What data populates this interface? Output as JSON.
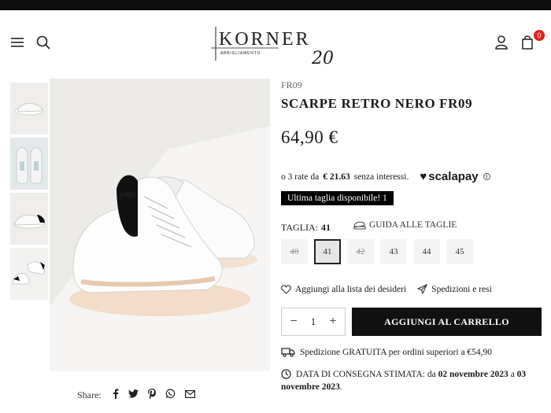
{
  "topbar": {
    "text": ""
  },
  "header": {
    "menu_icon": "menu-icon",
    "search_icon": "search-icon",
    "logo": {
      "brand": "KORNER",
      "number": "20",
      "tagline": "ABBIGLIAMENTO"
    },
    "account_icon": "user-icon",
    "cart_icon": "bag-icon",
    "cart_count": "0"
  },
  "product": {
    "sku": "FR09",
    "title": "SCARPE RETRO NERO FR09",
    "price": "64,90 €",
    "installments": {
      "prefix": "o 3 rate da",
      "amount": "€ 21.63",
      "suffix": "senza interessi.",
      "provider": "scalapay"
    },
    "stock_badge": "Ultima taglia disponibile! 1",
    "size_label": "TAGLIA:",
    "size_selected": "41",
    "size_guide": "GUIDA ALLE TAGLIE",
    "sizes": [
      {
        "label": "40",
        "state": "sold"
      },
      {
        "label": "41",
        "state": "selected"
      },
      {
        "label": "42",
        "state": "sold"
      },
      {
        "label": "43",
        "state": "available"
      },
      {
        "label": "44",
        "state": "available"
      },
      {
        "label": "45",
        "state": "available"
      }
    ],
    "wishlist": "Aggiungi alla lista dei desideri",
    "shipping_returns": "Spedizioni e resi",
    "quantity": "1",
    "add_to_cart": "AGGIUNGI AL CARRELLO",
    "free_shipping": "Spedizione GRATUITA per ordini superiori a €54,90",
    "delivery_prefix": "DATA DI CONSEGNA STIMATA: da",
    "delivery_from": "02 novembre 2023",
    "delivery_mid": "a",
    "delivery_to": "03 novembre 2023",
    "delivery_end": "."
  },
  "share": {
    "label": "Share:",
    "icons": [
      "facebook-icon",
      "twitter-icon",
      "pinterest-icon",
      "whatsapp-icon",
      "email-icon"
    ]
  },
  "colors": {
    "black": "#0d0d0d",
    "badge_red": "#e0211b"
  }
}
